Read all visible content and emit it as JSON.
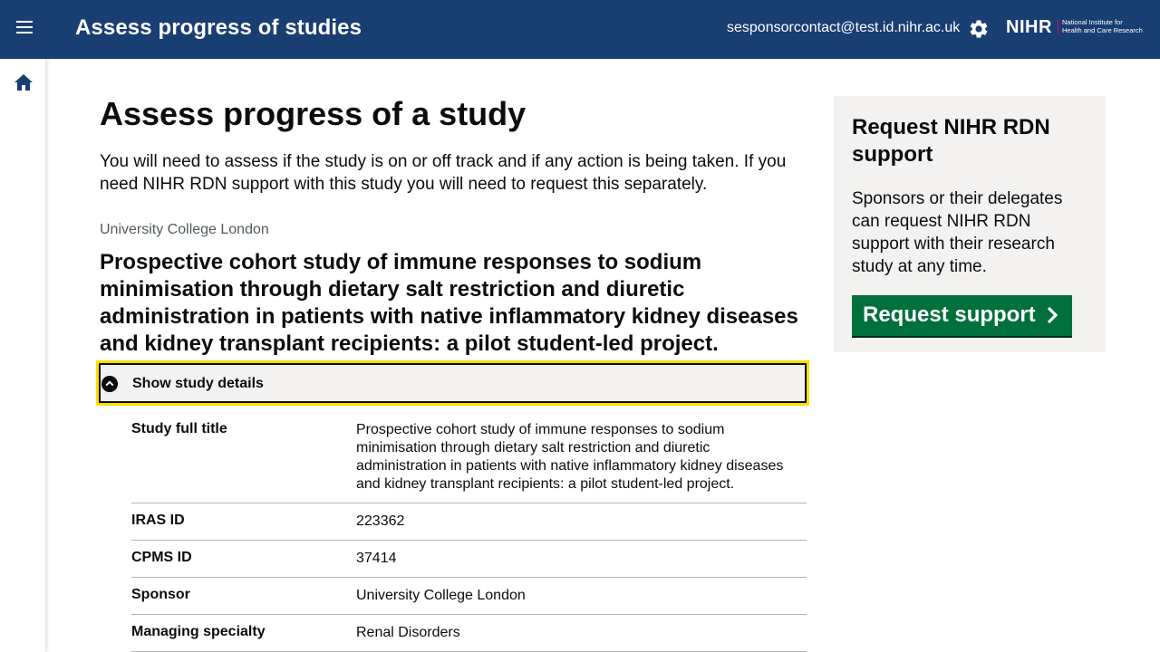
{
  "header": {
    "app_title": "Assess progress of studies",
    "user_email": "sesponsorcontact@test.id.nihr.ac.uk",
    "logo": {
      "wordmark": "NIHR",
      "line1": "National Institute for",
      "line2": "Health and Care Research"
    },
    "icons": [
      "menu-icon",
      "gear-icon"
    ]
  },
  "sidebar": {
    "icons": [
      "home-icon"
    ]
  },
  "page": {
    "heading": "Assess progress of a study",
    "lead": "You will need to assess if the study is on or off track and if any action is being taken. If you need NIHR RDN support with this study you will need to request this separately.",
    "organisation": "University College London",
    "study_title": "Prospective cohort study of immune responses to sodium minimisation through dietary salt restriction and diuretic administration in patients with native inflammatory kidney diseases and kidney transplant recipients: a pilot student-led project.",
    "details_toggle": "Show study details",
    "summary": [
      {
        "key": "Study full title",
        "value": "Prospective cohort study of immune responses to sodium minimisation through dietary salt restriction and diuretic administration in patients with native inflammatory kidney diseases and kidney transplant recipients: a pilot student-led project."
      },
      {
        "key": "IRAS ID",
        "value": "223362"
      },
      {
        "key": "CPMS ID",
        "value": "37414"
      },
      {
        "key": "Sponsor",
        "value": "University College London"
      },
      {
        "key": "Managing specialty",
        "value": "Renal Disorders"
      }
    ]
  },
  "aside": {
    "heading": "Request NIHR RDN support",
    "body": "Sponsors or their delegates can request NIHR RDN support with their research study at any time.",
    "button_label": "Request support"
  },
  "colors": {
    "header_bg": "#193e72",
    "button_bg": "#00703c",
    "focus": "#ffdd00",
    "panel_bg": "#f3f2f1"
  }
}
